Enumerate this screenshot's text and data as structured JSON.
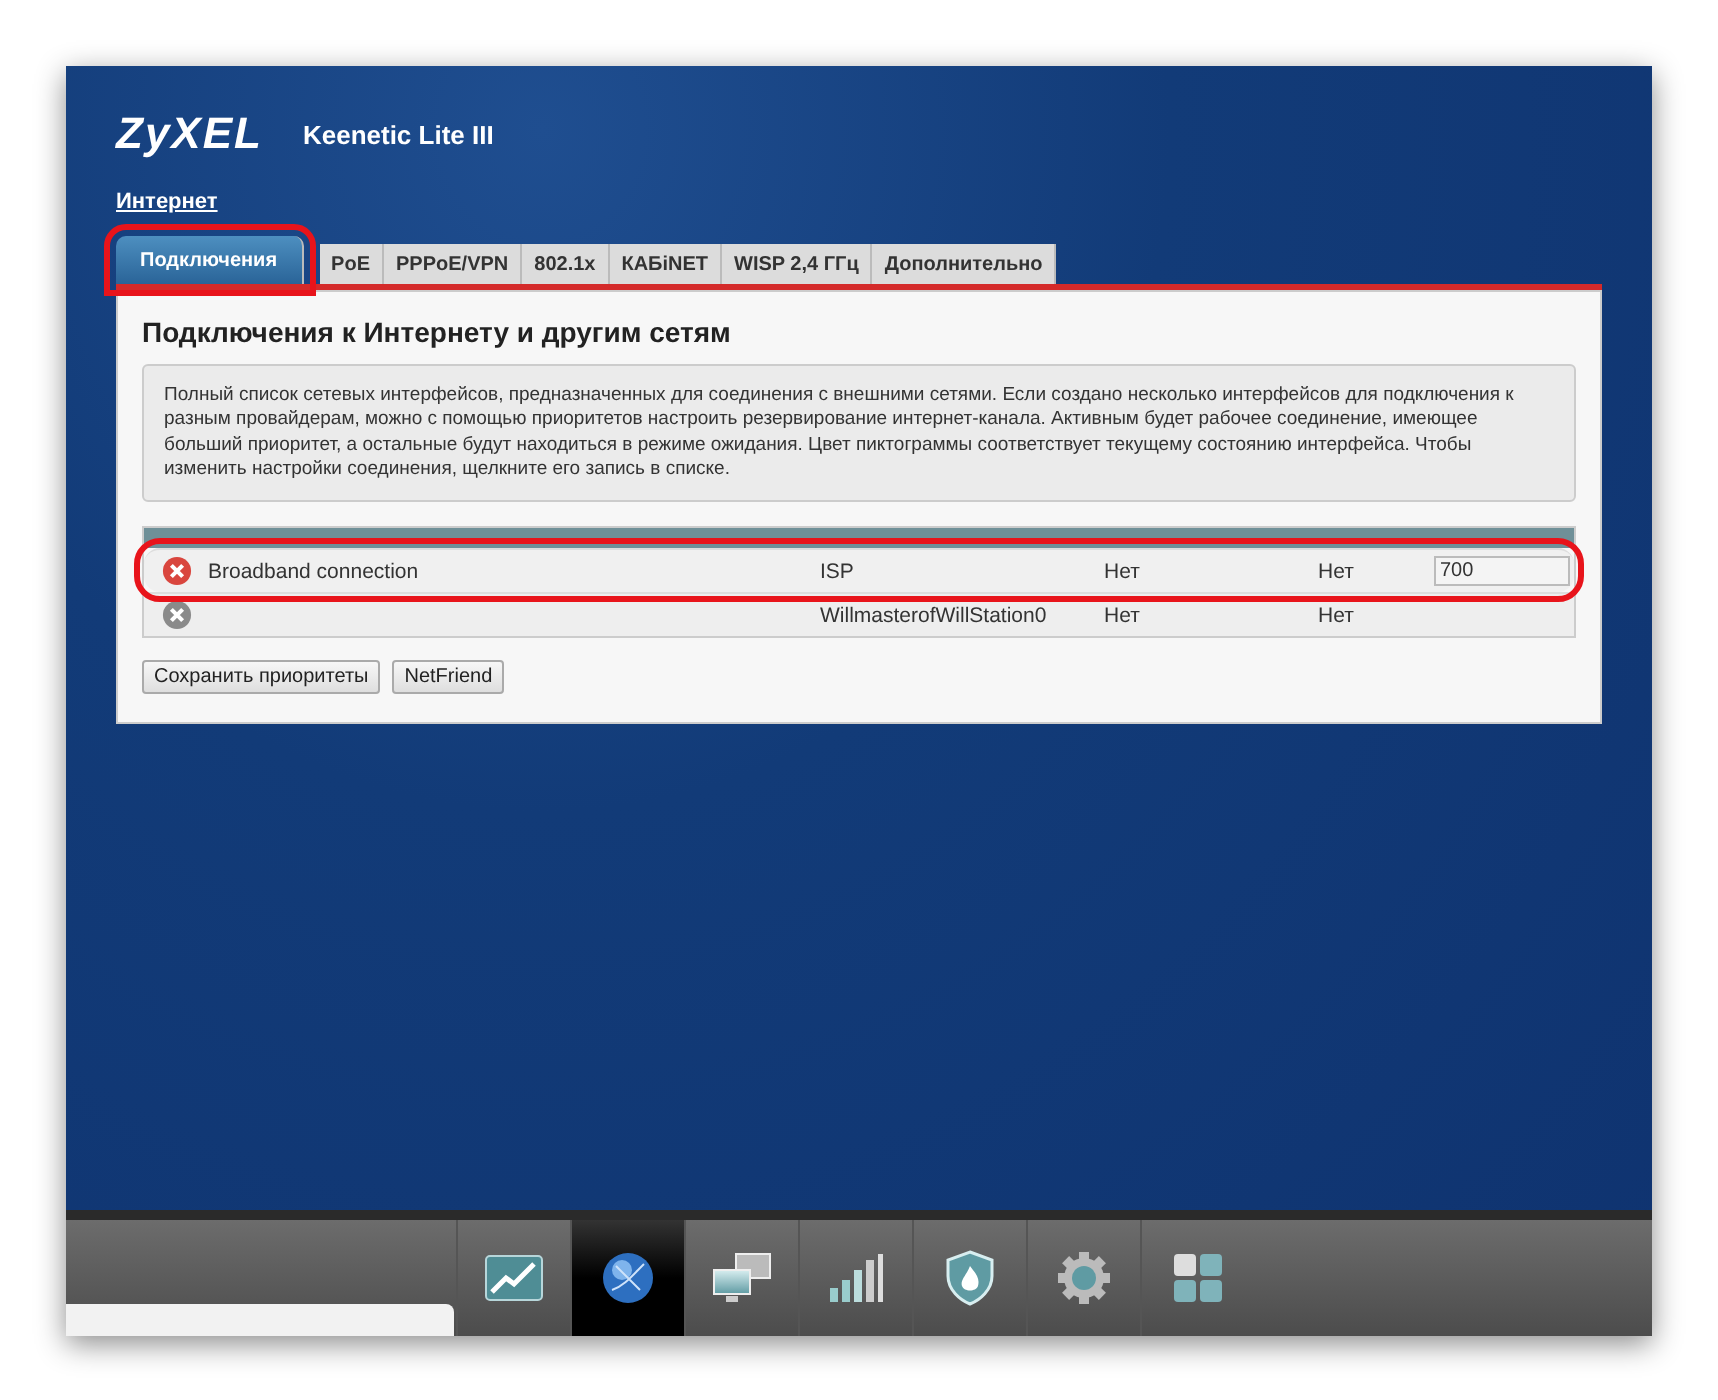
{
  "header": {
    "logo": "ZyXEL",
    "model": "Keenetic Lite III"
  },
  "section": "Интернет",
  "tabs": [
    {
      "label": "Подключения",
      "selected": true,
      "highlighted": true
    },
    {
      "label": "PoE",
      "selected": false,
      "highlighted": false
    },
    {
      "label": "PPPoE/VPN",
      "selected": false,
      "highlighted": false
    },
    {
      "label": "802.1x",
      "selected": false,
      "highlighted": false
    },
    {
      "label": "КАБiNET",
      "selected": false,
      "highlighted": false
    },
    {
      "label": "WISP 2,4 ГГц",
      "selected": false,
      "highlighted": false
    },
    {
      "label": "Дополнительно",
      "selected": false,
      "highlighted": false
    }
  ],
  "panel": {
    "title": "Подключения к Интернету и другим сетям",
    "info": "Полный список сетевых интерфейсов, предназначенных для соединения с внешними сетями. Если создано несколько интерфейсов для подключения к разным провайдерам, можно с помощью приоритетов настроить резервирование интернет-канала. Активным будет рабочее соединение, имеющее больший приоритет, а остальные будут находиться в режиме ожидания. Цвет пиктограммы соответствует текущему состоянию интерфейса. Чтобы изменить настройки соединения, щелкните его запись в списке.",
    "rows": [
      {
        "color": "#d9463e",
        "name": "Broadband connection",
        "interface": "ISP",
        "ip": "Нет",
        "internet": "Нет",
        "priority": "700",
        "highlighted": true
      },
      {
        "color": "#8a8a8a",
        "interface": "WillmasterofWillStation0",
        "ip": "Нет",
        "internet": "Нет",
        "highlighted": false
      }
    ],
    "buttons": [
      "Сохранить приоритеты",
      "NetFriend"
    ]
  },
  "taskbar": [
    {
      "selected": false
    },
    {
      "selected": true
    },
    {
      "selected": false
    },
    {
      "selected": false
    },
    {
      "selected": false
    },
    {
      "selected": false
    },
    {
      "selected": false
    }
  ]
}
